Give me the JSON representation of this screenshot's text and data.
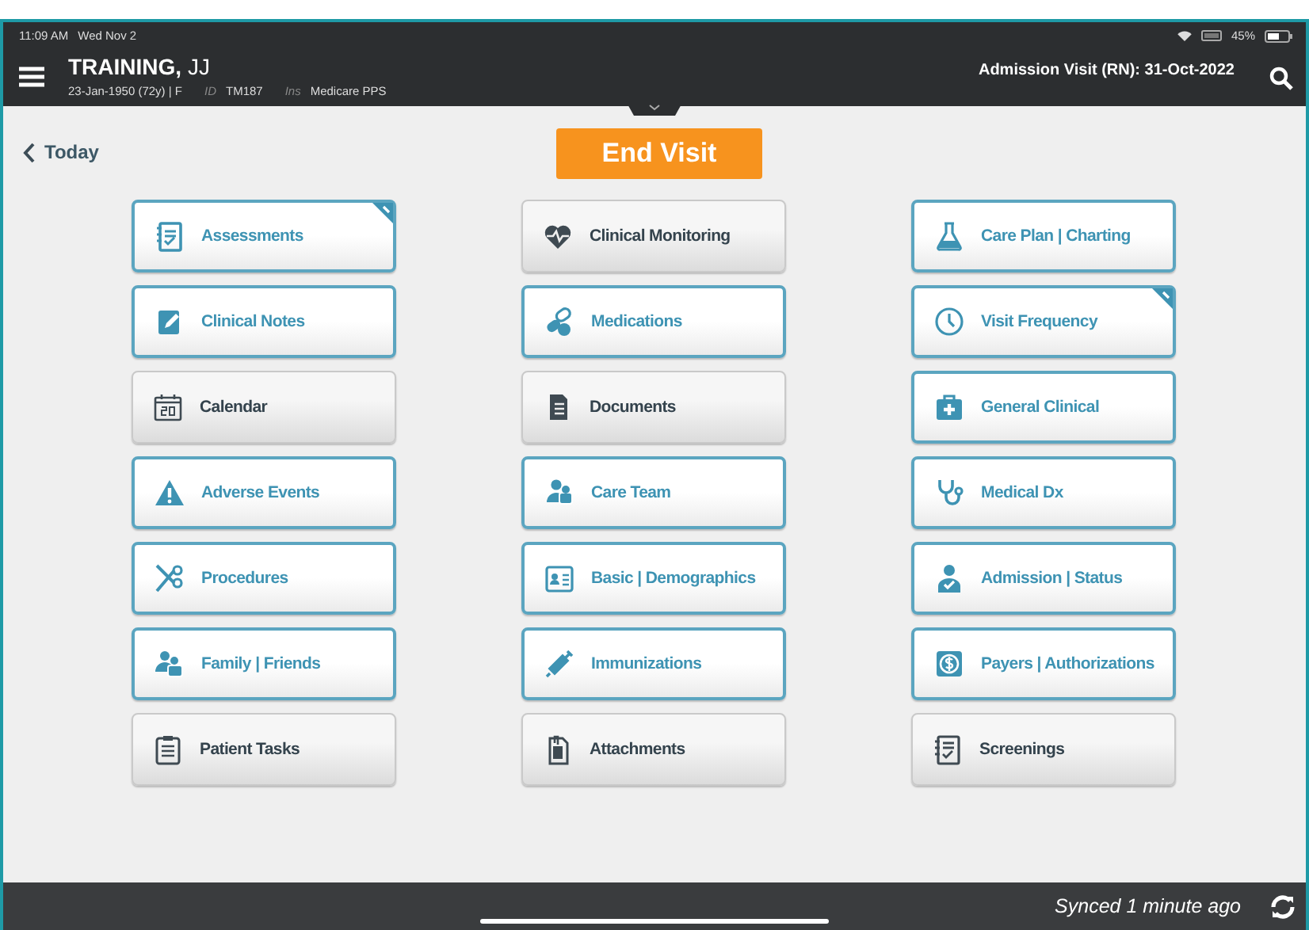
{
  "status_bar": {
    "time": "11:09 AM",
    "date": "Wed Nov 2",
    "battery": "45%"
  },
  "header": {
    "patient_name": "**TRAINING,** JJ",
    "dob": "23-Jan-1950 (72y) | F",
    "id_label": "ID",
    "id": "TM187",
    "ins_label": "Ins",
    "insurance": "Medicare PPS",
    "visit": "Admission Visit (RN): 31-Oct-2022"
  },
  "back_link": "Today",
  "end_visit_button": "End Visit",
  "tiles": [
    {
      "label": "Assessments",
      "kind": "active",
      "flagged": true
    },
    {
      "label": "Clinical Monitoring",
      "kind": "inactive",
      "flagged": false
    },
    {
      "label": "Care Plan | Charting",
      "kind": "active",
      "flagged": false
    },
    {
      "label": "Clinical Notes",
      "kind": "active",
      "flagged": false
    },
    {
      "label": "Medications",
      "kind": "active",
      "flagged": false
    },
    {
      "label": "Visit Frequency",
      "kind": "active",
      "flagged": true
    },
    {
      "label": "Calendar",
      "kind": "inactive",
      "flagged": false
    },
    {
      "label": "Documents",
      "kind": "inactive",
      "flagged": false
    },
    {
      "label": "General Clinical",
      "kind": "active",
      "flagged": false
    },
    {
      "label": "Adverse Events",
      "kind": "active",
      "flagged": false
    },
    {
      "label": "Care Team",
      "kind": "active",
      "flagged": false
    },
    {
      "label": "Medical Dx",
      "kind": "active",
      "flagged": false
    },
    {
      "label": "Procedures",
      "kind": "active",
      "flagged": false
    },
    {
      "label": "Basic | Demographics",
      "kind": "active",
      "flagged": false
    },
    {
      "label": "Admission | Status",
      "kind": "active",
      "flagged": false
    },
    {
      "label": "Family | Friends",
      "kind": "active",
      "flagged": false
    },
    {
      "label": "Immunizations",
      "kind": "active",
      "flagged": false
    },
    {
      "label": "Payers | Authorizations",
      "kind": "active",
      "flagged": false
    },
    {
      "label": "Patient Tasks",
      "kind": "inactive",
      "flagged": false
    },
    {
      "label": "Attachments",
      "kind": "inactive",
      "flagged": false
    },
    {
      "label": "Screenings",
      "kind": "inactive",
      "flagged": false
    }
  ],
  "footer": {
    "sync_status": "Synced 1 minute ago"
  }
}
